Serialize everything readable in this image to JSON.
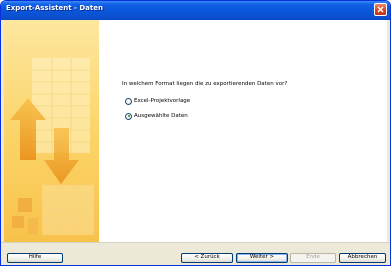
{
  "window": {
    "title": "Export-Assistent - Daten"
  },
  "main": {
    "question": "In welchem Format liegen die zu exportierenden Daten vor?",
    "options": [
      {
        "label": "Excel-Projektvorlage",
        "selected": false
      },
      {
        "label": "Ausgewählte Daten",
        "selected": true
      }
    ]
  },
  "buttons": {
    "help": "Hilfe",
    "back": "< Zurück",
    "next": "Weiter >",
    "finish": "Ende",
    "cancel": "Abbrechen"
  },
  "colors": {
    "titlebar": "#0a55d8",
    "side_panel": "#fbd76d",
    "side_arrows": "#f0a020",
    "window_bg": "#ece9d8"
  }
}
